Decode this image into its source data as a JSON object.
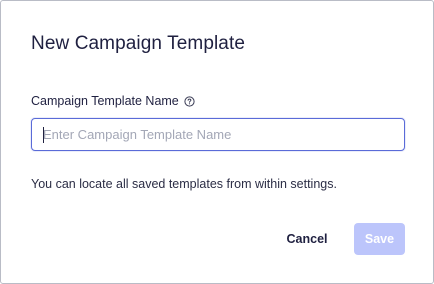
{
  "dialog": {
    "title": "New Campaign Template",
    "field": {
      "label": "Campaign Template Name",
      "help_icon": "question-circle-icon",
      "placeholder": "Enter Campaign Template Name",
      "value": ""
    },
    "hint": "You can locate all saved templates from within settings.",
    "buttons": {
      "cancel_label": "Cancel",
      "save_label": "Save",
      "save_disabled": true
    }
  },
  "colors": {
    "text": "#1f2040",
    "border": "#b9bcc6",
    "input_focus_border": "#5a6bd8",
    "placeholder": "#a3a7b6",
    "save_disabled_bg": "#bcc5fb"
  }
}
